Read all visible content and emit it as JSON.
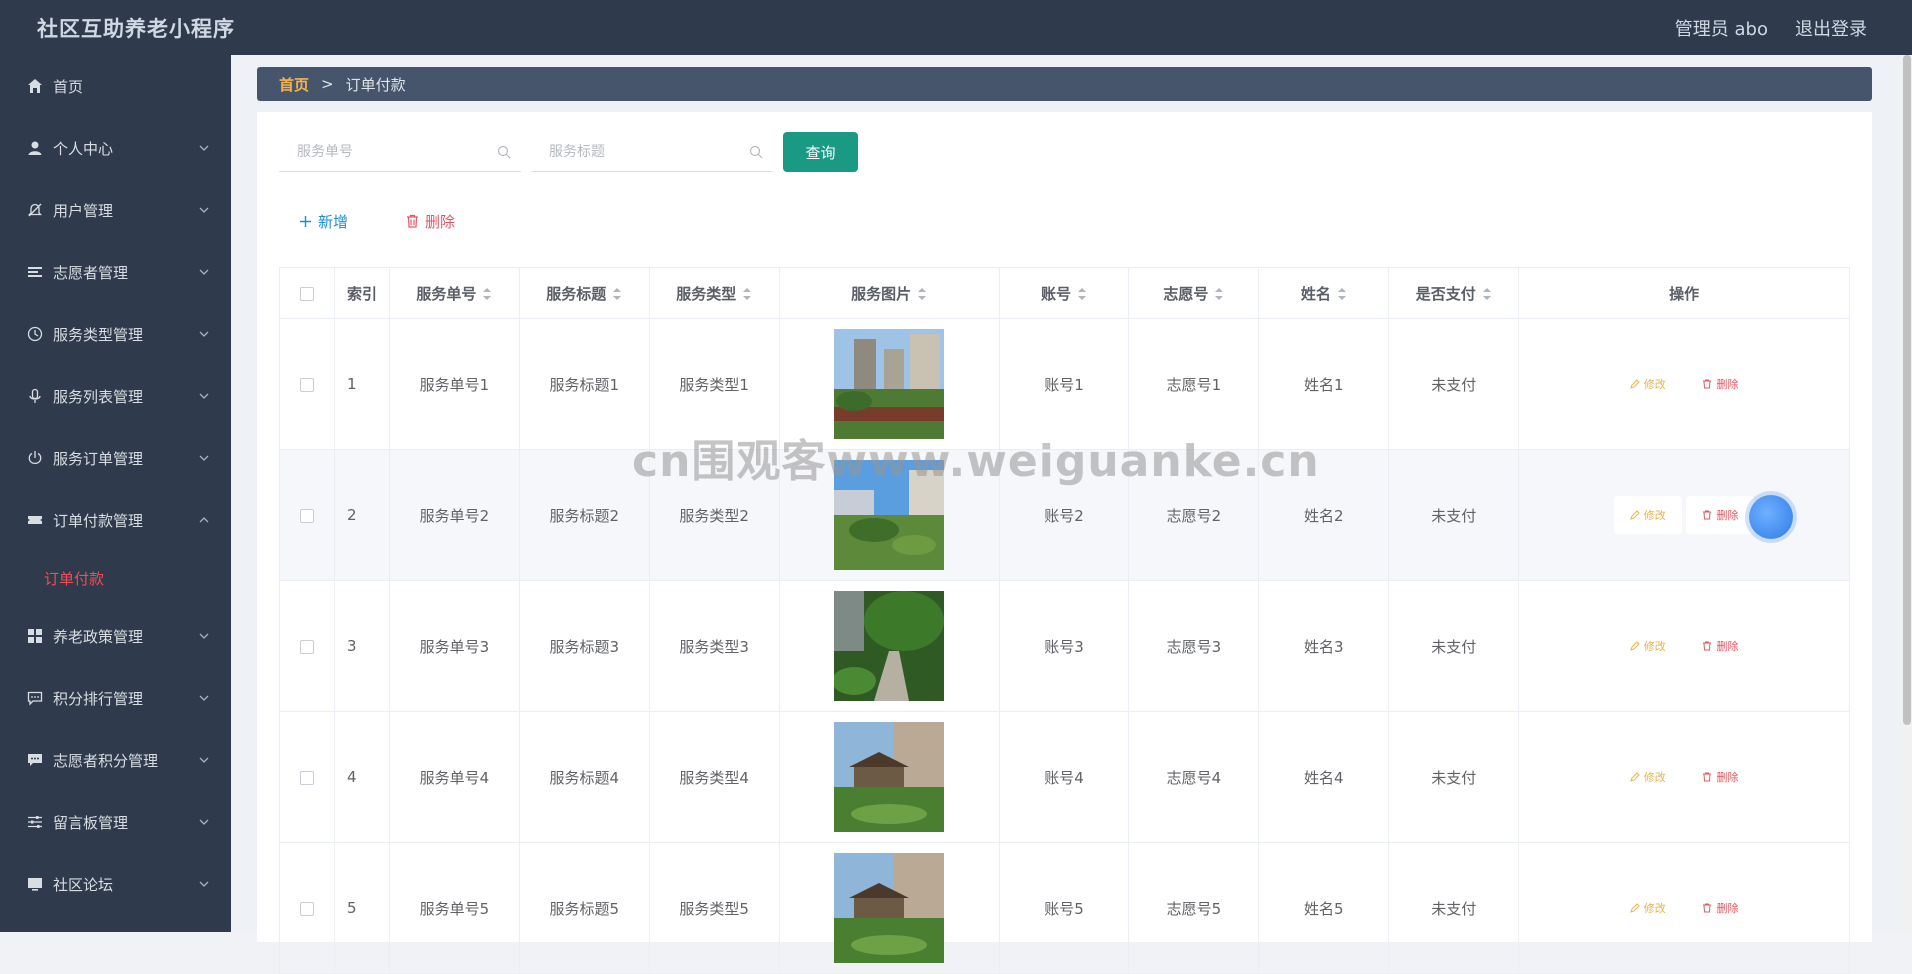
{
  "app_title": "社区互助养老小程序",
  "header": {
    "admin_label": "管理员 abo",
    "logout_label": "退出登录"
  },
  "sidebar": {
    "items": [
      {
        "label": "首页",
        "icon": "home-icon",
        "has_arrow": false
      },
      {
        "label": "个人中心",
        "icon": "user-icon",
        "has_arrow": true
      },
      {
        "label": "用户管理",
        "icon": "bell-off-icon",
        "has_arrow": true
      },
      {
        "label": "志愿者管理",
        "icon": "list-icon",
        "has_arrow": true
      },
      {
        "label": "服务类型管理",
        "icon": "clock-icon",
        "has_arrow": true
      },
      {
        "label": "服务列表管理",
        "icon": "mic-icon",
        "has_arrow": true
      },
      {
        "label": "服务订单管理",
        "icon": "power-icon",
        "has_arrow": true
      },
      {
        "label": "订单付款管理",
        "icon": "ticket-icon",
        "has_arrow": true,
        "expanded": true
      },
      {
        "label": "养老政策管理",
        "icon": "grid-icon",
        "has_arrow": true
      },
      {
        "label": "积分排行管理",
        "icon": "chat-icon",
        "has_arrow": true
      },
      {
        "label": "志愿者积分管理",
        "icon": "message-icon",
        "has_arrow": true
      },
      {
        "label": "留言板管理",
        "icon": "sliders-icon",
        "has_arrow": true
      },
      {
        "label": "社区论坛",
        "icon": "monitor-icon",
        "has_arrow": true
      }
    ],
    "active_sub": "订单付款"
  },
  "breadcrumb": {
    "home": "首页",
    "separator": ">",
    "current": "订单付款"
  },
  "search": {
    "order_placeholder": "服务单号",
    "title_placeholder": "服务标题",
    "query_label": "查询"
  },
  "actions": {
    "add_label": "新增",
    "delete_label": "删除"
  },
  "table": {
    "headers": [
      "索引",
      "服务单号",
      "服务标题",
      "服务类型",
      "服务图片",
      "账号",
      "志愿号",
      "姓名",
      "是否支付",
      "操作"
    ],
    "rows": [
      {
        "index": "1",
        "order": "服务单号1",
        "title": "服务标题1",
        "type": "服务类型1",
        "account": "账号1",
        "volunteer": "志愿号1",
        "name": "姓名1",
        "paid": "未支付"
      },
      {
        "index": "2",
        "order": "服务单号2",
        "title": "服务标题2",
        "type": "服务类型2",
        "account": "账号2",
        "volunteer": "志愿号2",
        "name": "姓名2",
        "paid": "未支付"
      },
      {
        "index": "3",
        "order": "服务单号3",
        "title": "服务标题3",
        "type": "服务类型3",
        "account": "账号3",
        "volunteer": "志愿号3",
        "name": "姓名3",
        "paid": "未支付"
      },
      {
        "index": "4",
        "order": "服务单号4",
        "title": "服务标题4",
        "type": "服务类型4",
        "account": "账号4",
        "volunteer": "志愿号4",
        "name": "姓名4",
        "paid": "未支付"
      },
      {
        "index": "5",
        "order": "服务单号5",
        "title": "服务标题5",
        "type": "服务类型5",
        "account": "账号5",
        "volunteer": "志愿号5",
        "name": "姓名5",
        "paid": "未支付"
      }
    ],
    "edit_label": "修改",
    "delete_label": "删除"
  },
  "watermark": "cn围观客www.weiguanke.cn",
  "colors": {
    "sidebar_bg": "#2f3b4c",
    "accent": "#1a9a85",
    "danger": "#e3575f",
    "warning": "#e9b24a",
    "link": "#1a8fd6"
  }
}
